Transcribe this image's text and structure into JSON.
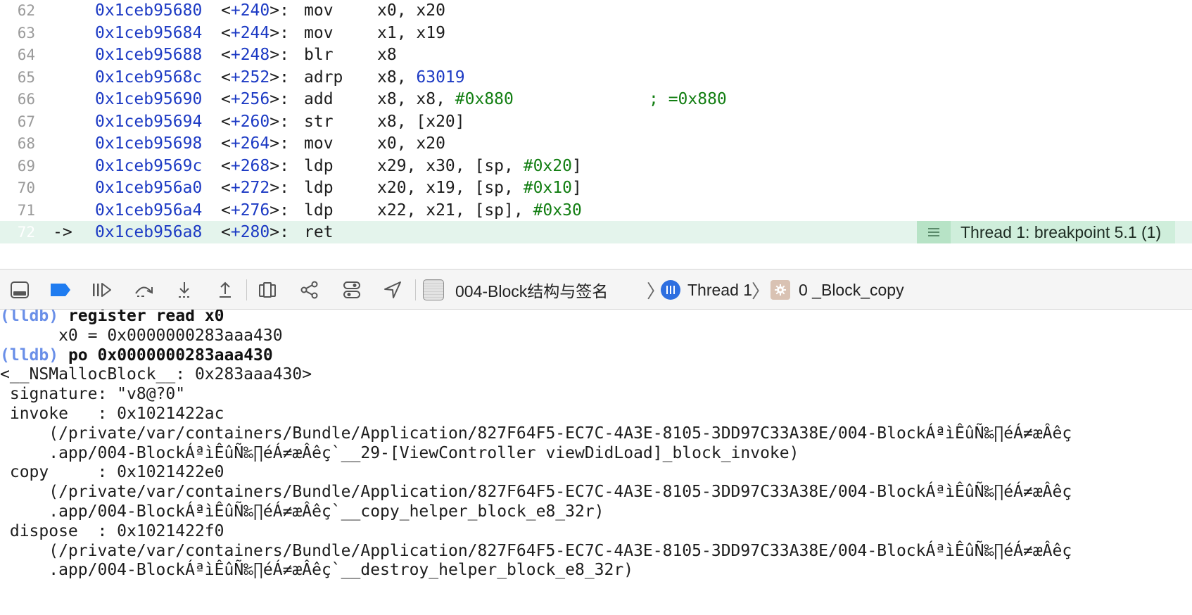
{
  "disassembly": {
    "lines": [
      {
        "ln": "62",
        "addr": "0x1ceb95680",
        "offset": "+240",
        "mnemonic": "mov",
        "operands": [
          {
            "t": "x0, x20",
            "c": ""
          }
        ],
        "comment": ""
      },
      {
        "ln": "63",
        "addr": "0x1ceb95684",
        "offset": "+244",
        "mnemonic": "mov",
        "operands": [
          {
            "t": "x1, x19",
            "c": ""
          }
        ],
        "comment": ""
      },
      {
        "ln": "64",
        "addr": "0x1ceb95688",
        "offset": "+248",
        "mnemonic": "blr",
        "operands": [
          {
            "t": "x8",
            "c": ""
          }
        ],
        "comment": ""
      },
      {
        "ln": "65",
        "addr": "0x1ceb9568c",
        "offset": "+252",
        "mnemonic": "adrp",
        "operands": [
          {
            "t": "x8, ",
            "c": ""
          },
          {
            "t": "63019",
            "c": "blue"
          }
        ],
        "comment": ""
      },
      {
        "ln": "66",
        "addr": "0x1ceb95690",
        "offset": "+256",
        "mnemonic": "add",
        "operands": [
          {
            "t": "x8, x8, ",
            "c": ""
          },
          {
            "t": "#0x880",
            "c": "green"
          }
        ],
        "comment": "; =0x880"
      },
      {
        "ln": "67",
        "addr": "0x1ceb95694",
        "offset": "+260",
        "mnemonic": "str",
        "operands": [
          {
            "t": "x8, [x20]",
            "c": ""
          }
        ],
        "comment": ""
      },
      {
        "ln": "68",
        "addr": "0x1ceb95698",
        "offset": "+264",
        "mnemonic": "mov",
        "operands": [
          {
            "t": "x0, x20",
            "c": ""
          }
        ],
        "comment": ""
      },
      {
        "ln": "69",
        "addr": "0x1ceb9569c",
        "offset": "+268",
        "mnemonic": "ldp",
        "operands": [
          {
            "t": "x29, x30, [sp, ",
            "c": ""
          },
          {
            "t": "#0x20",
            "c": "green"
          },
          {
            "t": "]",
            "c": ""
          }
        ],
        "comment": ""
      },
      {
        "ln": "70",
        "addr": "0x1ceb956a0",
        "offset": "+272",
        "mnemonic": "ldp",
        "operands": [
          {
            "t": "x20, x19, [sp, ",
            "c": ""
          },
          {
            "t": "#0x10",
            "c": "green"
          },
          {
            "t": "]",
            "c": ""
          }
        ],
        "comment": ""
      },
      {
        "ln": "71",
        "addr": "0x1ceb956a4",
        "offset": "+276",
        "mnemonic": "ldp",
        "operands": [
          {
            "t": "x22, x21, [sp], ",
            "c": ""
          },
          {
            "t": "#0x30",
            "c": "green"
          }
        ],
        "comment": ""
      },
      {
        "ln": "72",
        "addr": "0x1ceb956a8",
        "offset": "+280",
        "mnemonic": "ret",
        "operands": [],
        "comment": "",
        "current": true,
        "arrow": "->"
      }
    ],
    "breakpoint_label": "Thread 1: breakpoint 5.1 (1)"
  },
  "debug_bar": {
    "breadcrumbs": {
      "target": "004-Block结构与签名",
      "thread": "Thread 1",
      "frame": "0 _Block_copy"
    },
    "icons": [
      "hide-debug-area-icon",
      "breakpoints-toggle-icon",
      "continue-icon",
      "step-over-icon",
      "step-into-icon",
      "step-out-icon",
      "debug-view-hierarchy-icon",
      "memory-graph-icon",
      "environment-overrides-icon",
      "simulate-location-icon"
    ]
  },
  "console": {
    "prompt": "(lldb)",
    "lines": [
      {
        "prompt": "(lldb)",
        "cmd": "register read x0"
      },
      {
        "text": "      x0 = 0x0000000283aaa430"
      },
      {
        "prompt": "(lldb)",
        "cmd": "po 0x0000000283aaa430"
      },
      {
        "text": "<__NSMallocBlock__: 0x283aaa430>"
      },
      {
        "text": " signature: \"v8@?0\""
      },
      {
        "text": " invoke   : 0x1021422ac"
      },
      {
        "text": "     (/private/var/containers/Bundle/Application/827F64F5-EC7C-4A3E-8105-3DD97C33A38E/004-BlockÁªìÊûÑ‰∏éÁ≠æÂêç"
      },
      {
        "text": "     .app/004-BlockÁªìÊûÑ‰∏éÁ≠æÂêç`__29-[ViewController viewDidLoad]_block_invoke)"
      },
      {
        "text": " copy     : 0x1021422e0"
      },
      {
        "text": "     (/private/var/containers/Bundle/Application/827F64F5-EC7C-4A3E-8105-3DD97C33A38E/004-BlockÁªìÊûÑ‰∏éÁ≠æÂêç"
      },
      {
        "text": "     .app/004-BlockÁªìÊûÑ‰∏éÁ≠æÂêç`__copy_helper_block_e8_32r)"
      },
      {
        "text": " dispose  : 0x1021422f0"
      },
      {
        "text": "     (/private/var/containers/Bundle/Application/827F64F5-EC7C-4A3E-8105-3DD97C33A38E/004-BlockÁªìÊûÑ‰∏éÁ≠æÂêç"
      },
      {
        "text": "     .app/004-BlockÁªìÊûÑ‰∏éÁ≠æÂêç`__destroy_helper_block_e8_32r)"
      }
    ]
  },
  "colors": {
    "address": "#1c3ac4",
    "immediate": "#127e12",
    "current_line_bg": "#e4f4ec",
    "breakpoint_tag_bg": "#cfeedb",
    "lldb_prompt": "#6a8fe8",
    "active_toggle": "#1f7cf0"
  }
}
